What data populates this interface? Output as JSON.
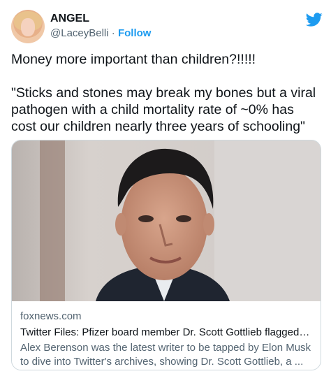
{
  "user": {
    "display_name": "ANGEL",
    "handle": "@LaceyBelli",
    "separator": " · ",
    "follow_label": "Follow"
  },
  "tweet": {
    "text": "Money more important than children?!!!!!\n\n\"Sticks and stones may break my bones but a viral pathogen with a child mortality rate of ~0% has cost our children nearly three years of schooling\""
  },
  "link_card": {
    "domain": "foxnews.com",
    "title": "Twitter Files: Pfizer board member Dr. Scott Gottlieb flagged t...",
    "description": "Alex Berenson was the latest writer to be tapped by Elon Musk to dive into Twitter's archives, showing Dr. Scott Gottlieb, a ..."
  },
  "icons": {
    "logo": "twitter-bird-icon",
    "avatar": "profile-photo"
  },
  "colors": {
    "accent": "#1d9bf0",
    "secondary_text": "#536471",
    "border": "#cfd9de"
  }
}
